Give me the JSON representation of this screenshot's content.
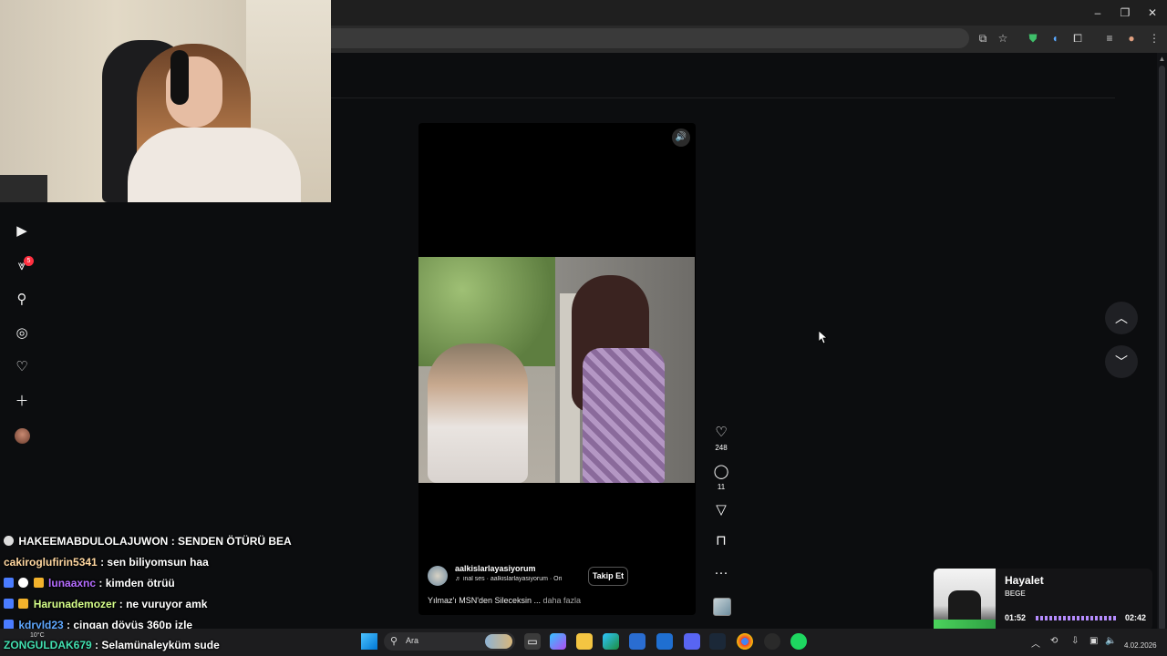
{
  "chat": [
    {
      "user": "HAKEEMABDULOLAJUWON",
      "message": ": SENDEN ÖTÜRÜ BEA",
      "color": "#ffffff"
    },
    {
      "user": "cakiroglufirin5341",
      "message": ": sen biliyomsun haa",
      "color": "#ffd7a0"
    },
    {
      "user": "lunaaxnc",
      "message": ": kimden ötrüü",
      "color": "#b56cff"
    },
    {
      "user": "Harunademozer",
      "message": ": ne vuruyor amk",
      "color": "#d6ff8a"
    },
    {
      "user": "kdryld23",
      "message": ": cingan dövüş 360p izle",
      "color": "#5fa8ff"
    },
    {
      "user": "ZONGULDAK679",
      "message": ": Selamünaleyküm sude",
      "color": "#42e0b0"
    }
  ],
  "sidebar": {
    "notification_count": "5"
  },
  "reel": {
    "username": "aalkislarlayasiyorum",
    "audio": "♬ inal ses · aalkislarlayasiyorum · Ori",
    "follow_label": "Takip Et",
    "caption": "Yılmaz'ı MSN'den Sileceksin ...",
    "more_label": "daha fazla",
    "likes": "248",
    "comments": "11"
  },
  "spotify": {
    "title": "Hayalet",
    "artist": "BEGE",
    "current_time": "01:52",
    "total_time": "02:42",
    "progress": 0.69
  },
  "taskbar": {
    "search_placeholder": "Ara",
    "weather": "10°C",
    "date": "4.02.2026"
  },
  "colors": {
    "accent_purple": "#9b6dff",
    "notification_red": "#ff3040",
    "page_bg": "#0c0d0f"
  }
}
